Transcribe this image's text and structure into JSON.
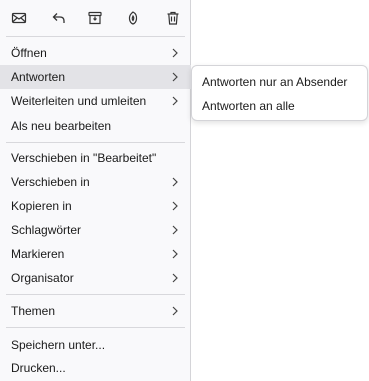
{
  "toolbar": {
    "icons": [
      "mark-read-icon",
      "reply-icon",
      "archive-icon",
      "junk-icon",
      "delete-icon"
    ]
  },
  "menu": {
    "items": [
      {
        "label": "Öffnen",
        "submenu": true
      },
      {
        "label": "Antworten",
        "submenu": true,
        "highlighted": true
      },
      {
        "label": "Weiterleiten und umleiten",
        "submenu": true
      },
      {
        "label": "Als neu bearbeiten",
        "submenu": false
      },
      {
        "label": "Verschieben in \"Bearbeitet\"",
        "submenu": false
      },
      {
        "label": "Verschieben in",
        "submenu": true
      },
      {
        "label": "Kopieren in",
        "submenu": true
      },
      {
        "label": "Schlagwörter",
        "submenu": true
      },
      {
        "label": "Markieren",
        "submenu": true
      },
      {
        "label": "Organisator",
        "submenu": true
      },
      {
        "label": "Themen",
        "submenu": true
      },
      {
        "label": "Speichern unter...",
        "submenu": false
      },
      {
        "label": "Drucken...",
        "submenu": false
      }
    ]
  },
  "submenu": {
    "items": [
      {
        "label": "Antworten nur an Absender"
      },
      {
        "label": "Antworten an alle"
      }
    ]
  },
  "colors": {
    "menu_bg": "#f9f9fb",
    "highlight": "#e3e3e7",
    "text": "#1a1a1a",
    "separator": "#d8d8dc"
  }
}
